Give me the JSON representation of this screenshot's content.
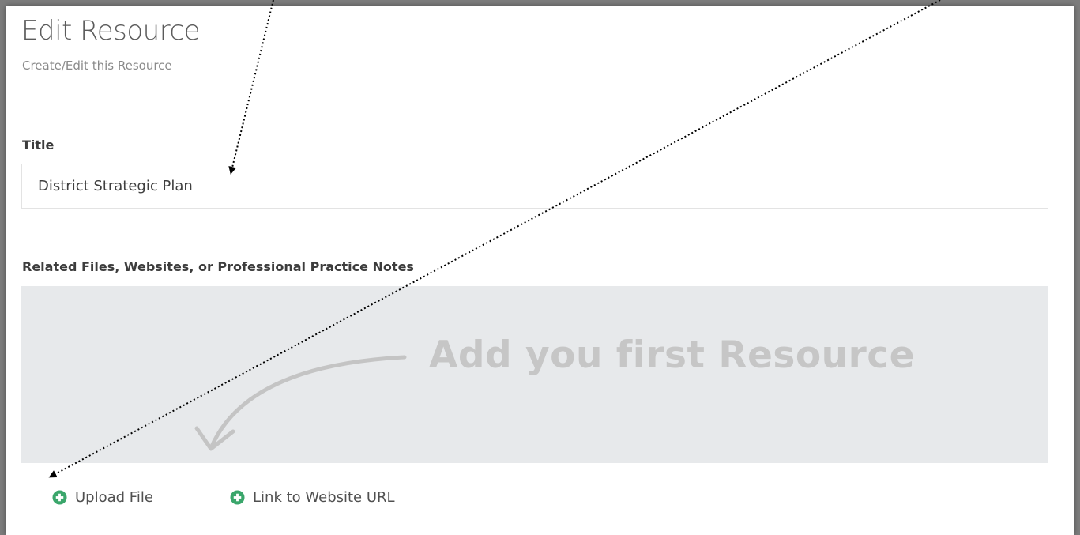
{
  "header": {
    "title": "Edit Resource",
    "subtitle": "Create/Edit this Resource"
  },
  "form": {
    "title_label": "Title",
    "title_value": "District Strategic Plan",
    "related_label": "Related Files, Websites, or Professional Practice Notes",
    "dropzone_text": "Add you first Resource"
  },
  "actions": {
    "upload_label": "Upload File",
    "link_label": "Link to Website URL"
  },
  "icons": {
    "upload": "plus-circle-icon",
    "link": "plus-circle-icon",
    "hint": "curved-arrow-icon"
  },
  "colors": {
    "accent_green": "#3aa66b",
    "dropzone_bg": "#e7e9eb",
    "dropzone_text": "#c6c6c6"
  }
}
